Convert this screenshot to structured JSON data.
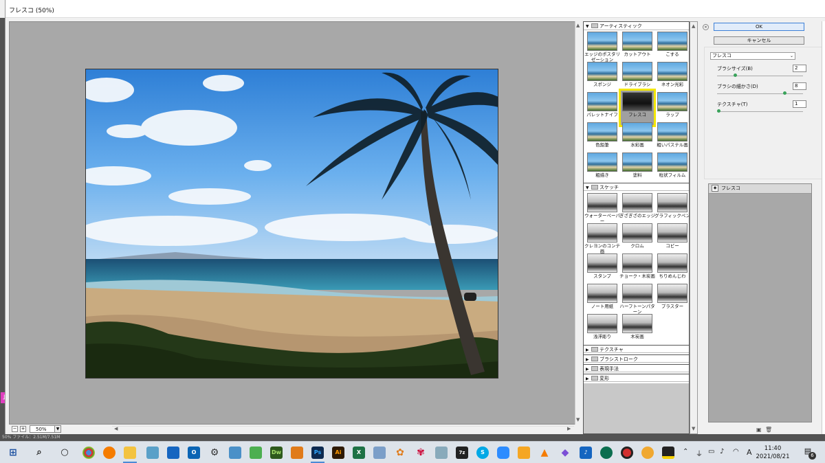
{
  "window": {
    "title": "フレスコ (50%)"
  },
  "preview": {
    "zoom": "50%"
  },
  "left_marker": "止",
  "gallery": {
    "categories": [
      {
        "name": "アーティスティック",
        "expanded": true,
        "items": [
          "エッジのポスタリゼーション",
          "カットアウト",
          "こする",
          "スポンジ",
          "ドライブラシ",
          "ネオン光彩",
          "パレットナイフ",
          "フレスコ",
          "ラップ",
          "色鉛筆",
          "水彩画",
          "粗いパステル画",
          "粗描き",
          "塗料",
          "粒状フィルム"
        ]
      },
      {
        "name": "スケッチ",
        "expanded": true,
        "items": [
          "ウォーターペーパー",
          "ぎざぎざのエッジ",
          "グラフィックペン",
          "クレヨンのコンテ画",
          "クロム",
          "コピー",
          "スタンプ",
          "チョーク・木炭画",
          "ちりめんじわ",
          "ノート用紙",
          "ハーフトーンパターン",
          "プラスター",
          "浅浮彫り",
          "木炭画"
        ]
      },
      {
        "name": "テクスチャ",
        "expanded": false
      },
      {
        "name": "ブラシストローク",
        "expanded": false
      },
      {
        "name": "表現手法",
        "expanded": false
      },
      {
        "name": "変形",
        "expanded": false
      }
    ],
    "selected": "フレスコ"
  },
  "panel": {
    "ok_label": "OK",
    "cancel_label": "キャンセル",
    "filter_select": "フレスコ",
    "params": [
      {
        "label": "ブラシサイズ(B)",
        "value": "2",
        "fraction": 0.2
      },
      {
        "label": "ブラシの細かさ(D)",
        "value": "8",
        "fraction": 0.8
      },
      {
        "label": "テクスチャ(T)",
        "value": "1",
        "fraction": 0.0
      }
    ],
    "layer_name": "フレスコ"
  },
  "statusbar": "50%    ファイル：2.51M/7.51M",
  "taskbar": {
    "time": "11:40",
    "date": "2021/08/21",
    "ime": "A",
    "notification_count": "6",
    "colors": {
      "accent": "#4a8ad6"
    }
  }
}
